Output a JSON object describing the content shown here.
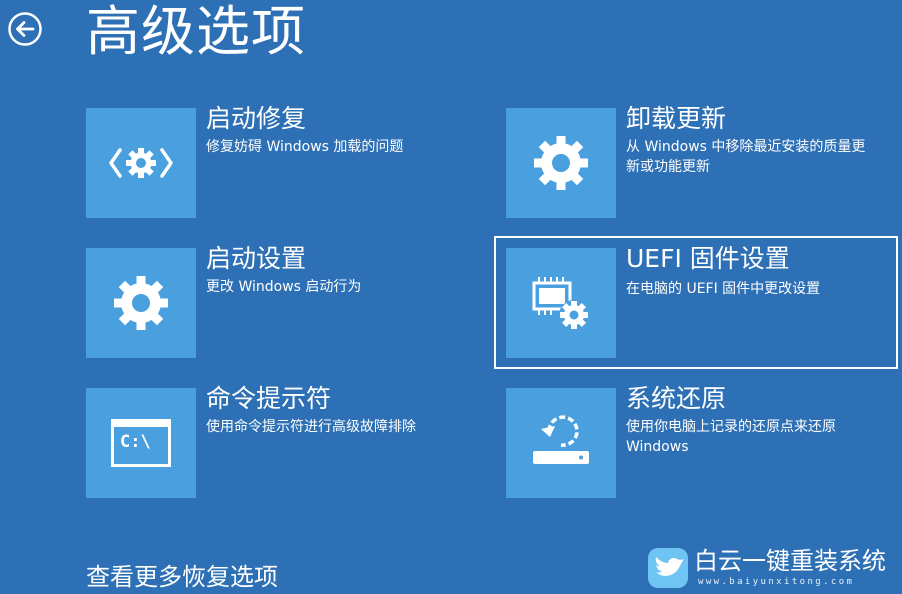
{
  "header": {
    "title": "高级选项",
    "back_icon": "back-arrow-circle-icon"
  },
  "options": [
    {
      "id": "startup-repair",
      "title": "启动修复",
      "description": "修复妨碍 Windows 加载的问题",
      "icon": "code-gear-icon"
    },
    {
      "id": "uninstall-updates",
      "title": "卸载更新",
      "description": "从 Windows 中移除最近安装的质量更新或功能更新",
      "icon": "gear-icon"
    },
    {
      "id": "startup-settings",
      "title": "启动设置",
      "description": "更改 Windows 启动行为",
      "icon": "gear-icon"
    },
    {
      "id": "uefi-firmware",
      "title": "UEFI 固件设置",
      "description": "在电脑的 UEFI 固件中更改设置",
      "icon": "chip-gear-icon",
      "selected": true
    },
    {
      "id": "command-prompt",
      "title": "命令提示符",
      "description": "使用命令提示符进行高级故障排除",
      "icon": "command-prompt-icon",
      "prompt_text": "C:\\"
    },
    {
      "id": "system-restore",
      "title": "系统还原",
      "description": "使用你电脑上记录的还原点来还原 Windows",
      "icon": "drive-restore-icon"
    }
  ],
  "footer": {
    "more_options_link": "查看更多恢复选项"
  },
  "watermark": {
    "title": "白云一键重装系统",
    "url": "www.baiyunxitong.com"
  },
  "colors": {
    "background": "#2d70b5",
    "tile": "#4a9fde",
    "text": "#ffffff",
    "watermark_logo": "#6ec4f2"
  }
}
